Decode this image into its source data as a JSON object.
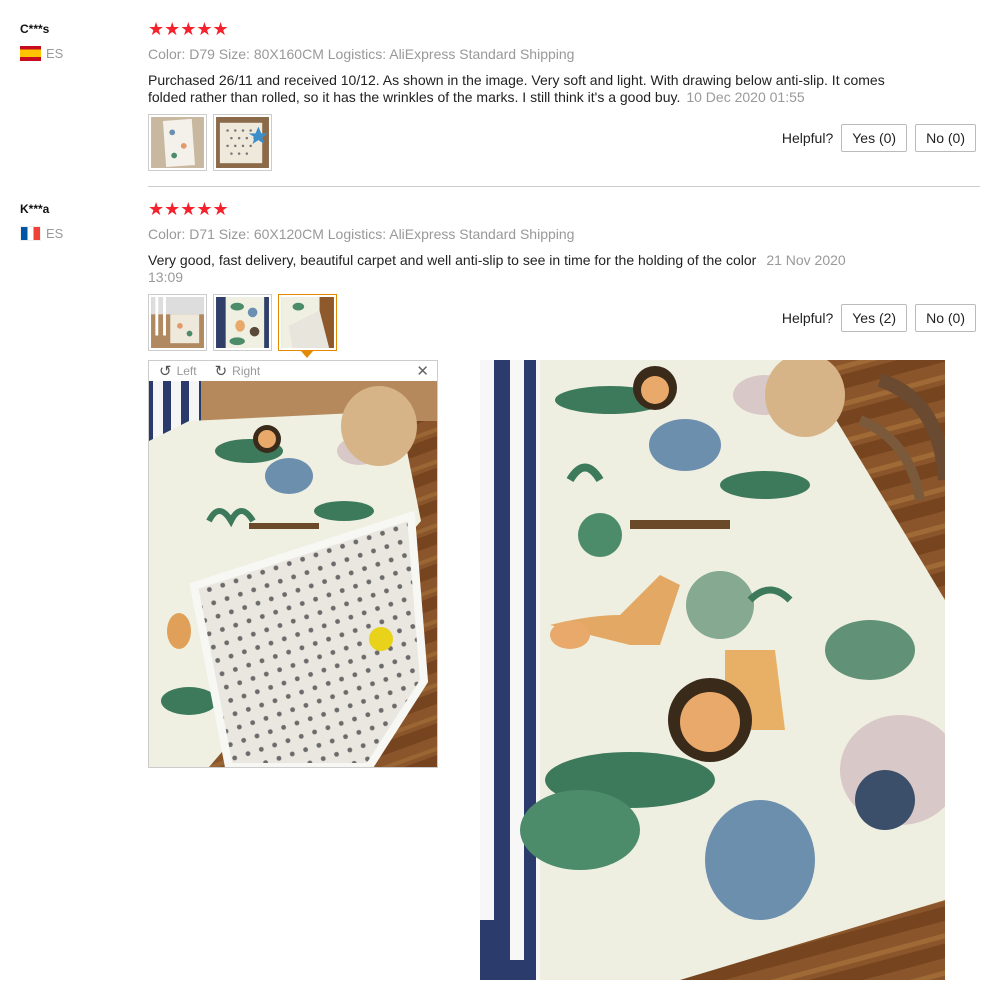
{
  "reviews": [
    {
      "user": "C***s",
      "country": "ES",
      "rating": "★★★★★",
      "meta": "Color: D79 Size: 80X160CM Logistics: AliExpress Standard Shipping",
      "text": "Purchased 26/11 and received 10/12. As shown in the image. Very soft and light. With drawing below anti-slip. It comes folded rather than rolled, so it has the wrinkles of the marks. I still think it's a good buy.",
      "date": "10 Dec 2020 01:55",
      "helpful_label": "Helpful?",
      "yes_label": "Yes (0)",
      "no_label": "No (0)"
    },
    {
      "user": "K***a",
      "country": "ES",
      "rating": "★★★★★",
      "meta": "Color: D71 Size: 60X120CM Logistics: AliExpress Standard Shipping",
      "text": "Very good, fast delivery, beautiful carpet and well anti-slip to see in time for the holding of the color",
      "date": "21 Nov 2020 13:09",
      "helpful_label": "Helpful?",
      "yes_label": "Yes (2)",
      "no_label": "No (0)"
    }
  ],
  "viewer": {
    "left_label": "Left",
    "right_label": "Right",
    "close_icon": "close-icon"
  },
  "colors": {
    "star": "#f5222d",
    "meta": "#999999",
    "active_thumb": "#e58a00"
  }
}
